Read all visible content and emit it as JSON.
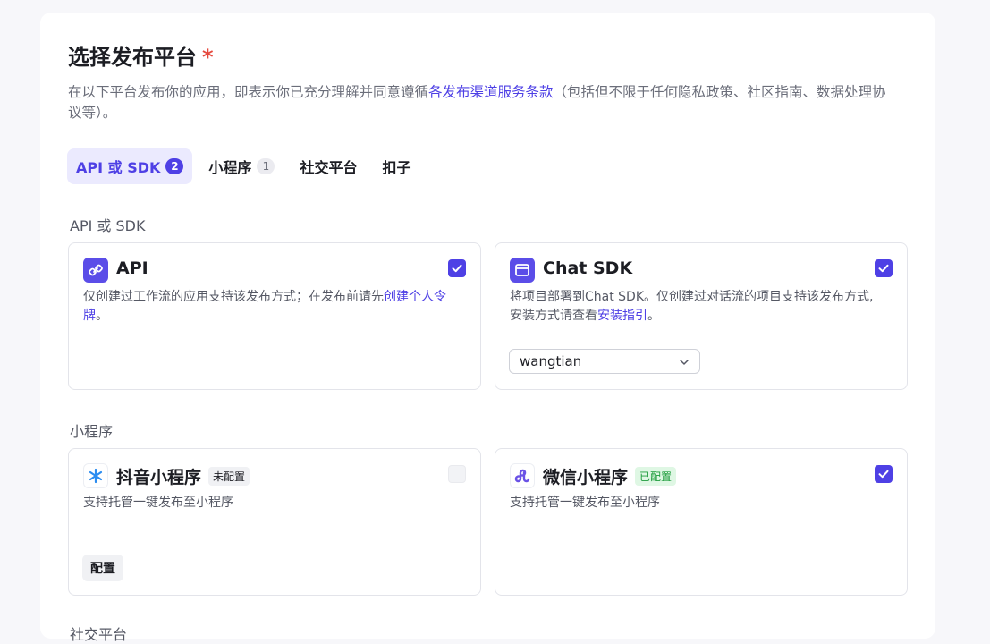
{
  "header": {
    "title": "选择发布平台",
    "required_mark": "*",
    "desc_prefix": "在以下平台发布你的应用，即表示你已充分理解并同意遵循",
    "desc_link": "各发布渠道服务条款",
    "desc_suffix": "（包括但不限于任何隐私政策、社区指南、数据处理协议等）。"
  },
  "tabs": [
    {
      "label": "API 或 SDK",
      "count": "2"
    },
    {
      "label": "小程序",
      "count": "1"
    },
    {
      "label": "社交平台"
    },
    {
      "label": "扣子"
    }
  ],
  "sections": {
    "api_sdk": {
      "label": "API 或 SDK",
      "cards": [
        {
          "name": "API",
          "desc_prefix": "仅创建过工作流的应用支持该发布方式；在发布前请先",
          "desc_link": "创建个人令牌",
          "desc_suffix": "。",
          "checked": true
        },
        {
          "name": "Chat SDK",
          "desc_prefix": "将项目部署到Chat SDK。仅创建过对话流的项目支持该发布方式,安装方式请查看",
          "desc_link": "安装指引",
          "desc_suffix": "。",
          "select_value": "wangtian",
          "checked": true
        }
      ]
    },
    "mini_program": {
      "label": "小程序",
      "cards": [
        {
          "name": "抖音小程序",
          "tag": "未配置",
          "desc": "支持托管一键发布至小程序",
          "button": "配置",
          "checked": false
        },
        {
          "name": "微信小程序",
          "tag": "已配置",
          "desc": "支持托管一键发布至小程序",
          "checked": true
        }
      ]
    },
    "social": {
      "label": "社交平台"
    }
  },
  "colors": {
    "accent": "#4e40e5",
    "tab_active_bg": "#ebeafe",
    "required": "#e5483d",
    "tag_green_bg": "#dff7e4",
    "tag_green_text": "#1f9c3d"
  }
}
